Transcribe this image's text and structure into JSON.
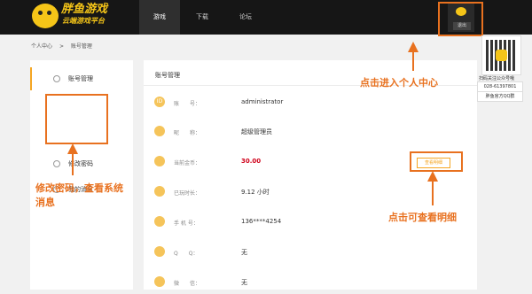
{
  "header": {
    "logo_name": "胖鱼游戏",
    "logo_sub": "云端游戏平台",
    "nav": [
      "游戏",
      "下载",
      "论坛"
    ],
    "logout_label": "退出"
  },
  "breadcrumb": [
    "个人中心",
    ">",
    "账号管理"
  ],
  "sidebar": {
    "items": [
      {
        "label": "账号管理",
        "icon": "user-icon"
      },
      {
        "label": "修改密码",
        "icon": "shield-icon"
      },
      {
        "label": "我的消息",
        "icon": "bell-icon"
      }
    ]
  },
  "panel": {
    "title": "账号管理",
    "rows": [
      {
        "icon": "id-icon",
        "icon_text": "ID",
        "label": "账　　号：",
        "value": "administrator"
      },
      {
        "icon": "person-icon",
        "icon_text": "",
        "label": "昵　　称：",
        "value": "超级管理员"
      },
      {
        "icon": "coin-icon",
        "icon_text": "",
        "label": "当前金币：",
        "value": "30.00",
        "button": "查看明细"
      },
      {
        "icon": "clock-icon",
        "icon_text": "",
        "label": "已玩时长：",
        "value": "9.12 小时"
      },
      {
        "icon": "phone-icon",
        "icon_text": "",
        "label": "手 机 号：",
        "value": "136****4254"
      },
      {
        "icon": "qq-icon",
        "icon_text": "",
        "label": "Q　　Q：",
        "value": "无"
      },
      {
        "icon": "wechat-icon",
        "icon_text": "",
        "label": "微　　信：",
        "value": "无"
      }
    ]
  },
  "right": {
    "qr_caption": "扫码关注公众号哦",
    "hotline": "028-61397801",
    "qq_group": "胖鱼官方QQ群"
  },
  "annotations": {
    "center": "点击进入个人中心",
    "password": "修改密码，查看系统消息",
    "detail": "点击可查看明细"
  },
  "colors": {
    "header_bg": "#161616",
    "accent": "#f5a623",
    "annotation": "#e8711f",
    "coin_value": "#d0021b"
  }
}
